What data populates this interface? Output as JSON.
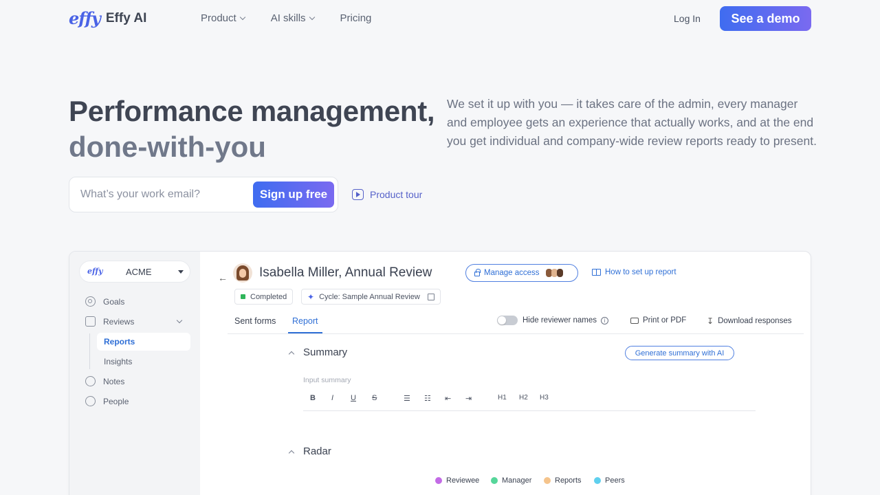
{
  "nav": {
    "logo_mark": "effy",
    "logo_text": "Effy AI",
    "links": [
      "Product",
      "AI skills",
      "Pricing"
    ],
    "login": "Log In",
    "cta": "See a demo"
  },
  "hero": {
    "title_line1": "Performance management,",
    "title_line2": "done-with-you",
    "description": "We set it up with you — it takes care of the admin, every manager and employee gets an experience that actually works, and at the end you get individual and company-wide review reports ready to present.",
    "email_placeholder": "What’s your work email?",
    "signup_label": "Sign up free",
    "tour_label": "Product tour"
  },
  "app": {
    "org": {
      "logo": "effy",
      "name": "ACME"
    },
    "sidebar": {
      "goals": "Goals",
      "reviews": "Reviews",
      "reports": "Reports",
      "insights": "Insights",
      "notes": "Notes",
      "people": "People"
    },
    "header": {
      "person": "Isabella Miller,",
      "review_type": "Annual Review",
      "manage_access": "Manage access",
      "how_to": "How to set up report",
      "status": "Completed",
      "cycle": "Cycle: Sample Annual Review"
    },
    "tabs": [
      "Sent forms",
      "Report"
    ],
    "tools": {
      "hide_names": "Hide reviewer names",
      "print": "Print or PDF",
      "download": "Download responses"
    },
    "summary": {
      "title": "Summary",
      "generate": "Generate summary with AI",
      "placeholder": "Input summary",
      "format_buttons": [
        "B",
        "I",
        "U",
        "S",
        "☰",
        "☷",
        "⇤",
        "⇥",
        "H1",
        "H2",
        "H3"
      ]
    },
    "radar": {
      "title": "Radar",
      "legend": [
        {
          "label": "Reviewee",
          "color": "#c36be6"
        },
        {
          "label": "Manager",
          "color": "#56d69a"
        },
        {
          "label": "Reports",
          "color": "#f5c48c"
        },
        {
          "label": "Peers",
          "color": "#5fd0ee"
        }
      ]
    }
  },
  "colors": {
    "accent": "#3f6cf0",
    "accent2": "#7a6af0",
    "link": "#2f6fd6"
  }
}
